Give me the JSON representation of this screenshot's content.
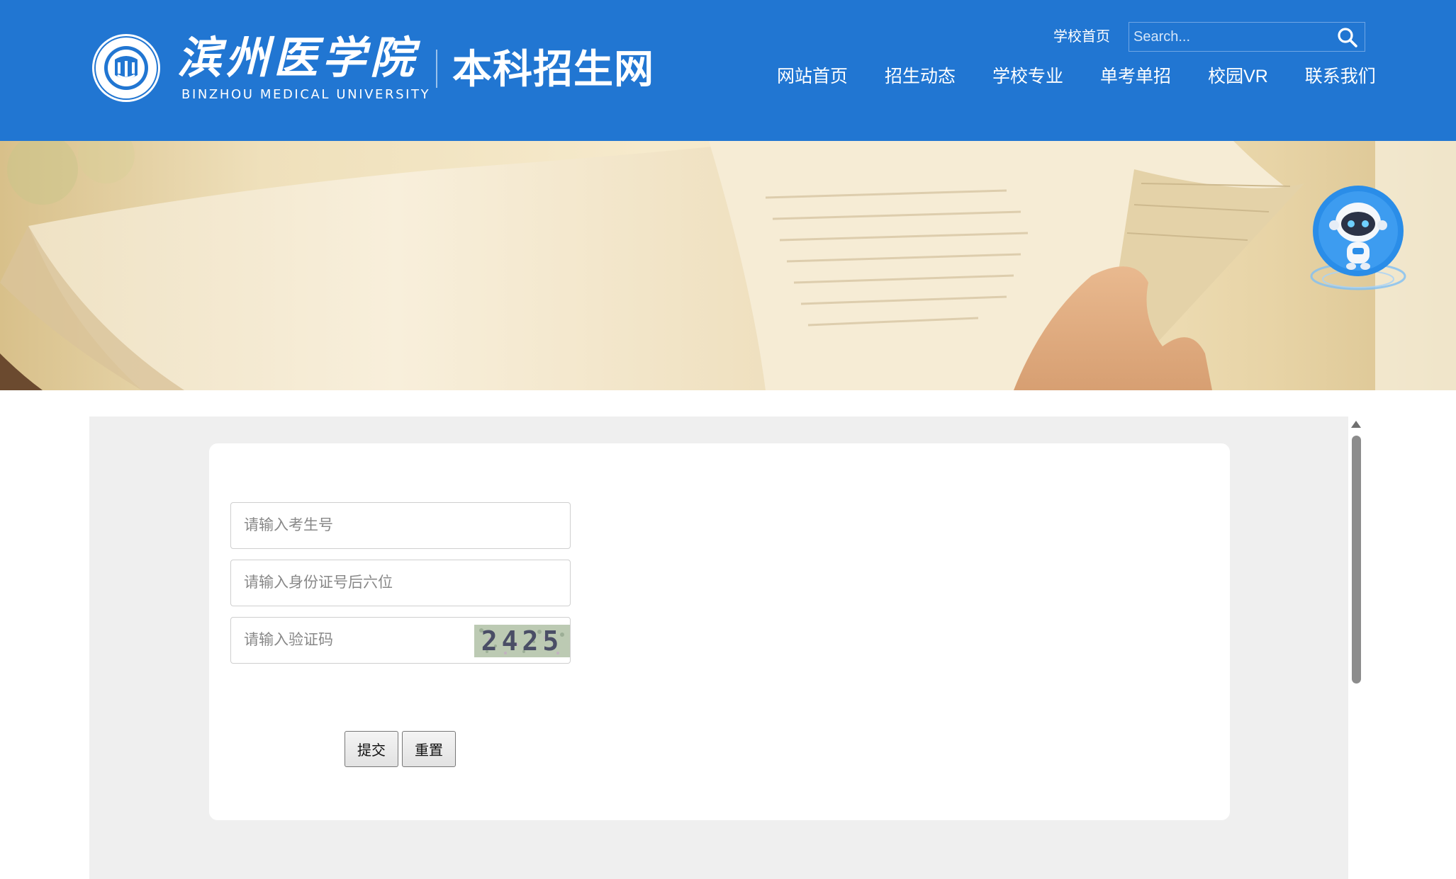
{
  "header": {
    "logo_cn": "滨州医学院",
    "logo_en": "BINZHOU MEDICAL UNIVERSITY",
    "site_title": "本科招生网",
    "school_home_link": "学校首页",
    "search": {
      "placeholder": "Search...",
      "value": ""
    },
    "nav": [
      {
        "label": "网站首页"
      },
      {
        "label": "招生动态"
      },
      {
        "label": "学校专业"
      },
      {
        "label": "单考单招"
      },
      {
        "label": "校园VR"
      },
      {
        "label": "联系我们"
      }
    ],
    "colors": {
      "brand_blue": "#2176d2"
    },
    "icons": {
      "search": "search-icon",
      "seal": "university-seal-logo"
    }
  },
  "banner": {
    "image": "open-book-photo"
  },
  "assistant": {
    "icon": "robot-assistant-icon"
  },
  "form": {
    "candidate_no": {
      "placeholder": "请输入考生号",
      "value": ""
    },
    "id_last_six": {
      "placeholder": "请输入身份证号后六位",
      "value": ""
    },
    "captcha_input": {
      "placeholder": "请输入验证码",
      "value": ""
    },
    "captcha_code": "2425",
    "submit_label": "提交",
    "reset_label": "重置"
  }
}
